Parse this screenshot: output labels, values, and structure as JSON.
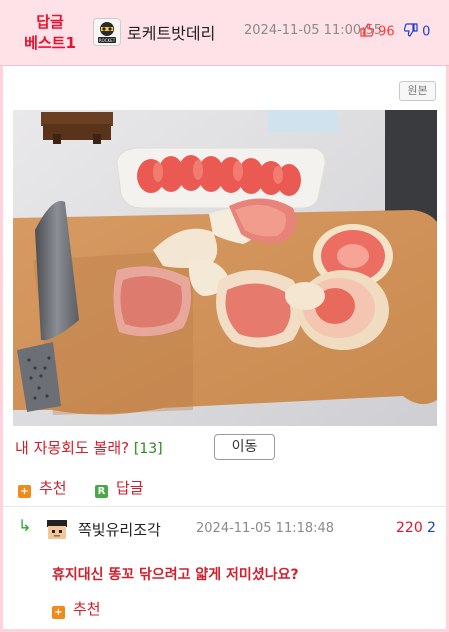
{
  "header": {
    "badge_line1": "답글",
    "badge_line2": "베스트1",
    "username": "로케트밧데리",
    "avatar_text": "ROCKET",
    "date": "2024-11-05 11:00:55",
    "upvotes": "96",
    "downvotes": "0"
  },
  "original_button": "원본",
  "post": {
    "title": "내 자몽회도 볼래?",
    "comment_count": "[13]",
    "move_button": "이동"
  },
  "actions": {
    "recommend": "추천",
    "reply": "답글"
  },
  "reply": {
    "username": "쪽빛유리조각",
    "date": "2024-11-05 11:18:48",
    "upvotes": "220",
    "downvotes": "2",
    "text": "휴지대신 똥꼬 닦으려고 얇게 저미셨나요?",
    "recommend": "추천"
  },
  "icons": {
    "reply_arrow": "reply-arrow-icon",
    "recommend": "plus-icon",
    "reply": "reply-icon"
  },
  "colors": {
    "header_bg": "#ffe1e8",
    "accent_red": "#d21f2b",
    "upvote": "#ff3b3b",
    "downvote": "#1a3fd6"
  }
}
